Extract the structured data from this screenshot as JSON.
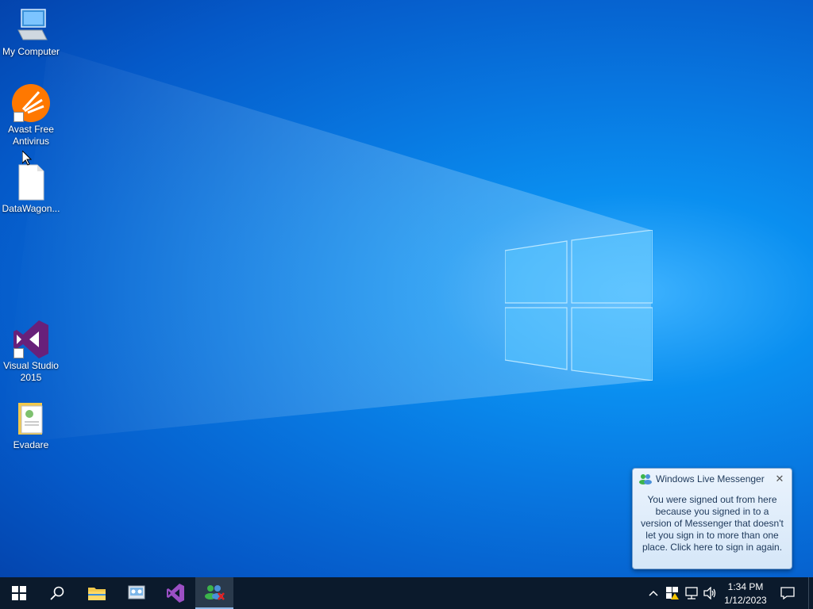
{
  "desktop": {
    "icons": [
      {
        "label": "My Computer",
        "icon": "computer-icon"
      },
      {
        "label": "Avast Free Antivirus",
        "icon": "avast-icon"
      },
      {
        "label": "DataWagon...",
        "icon": "file-icon"
      },
      {
        "label": "Visual Studio 2015",
        "icon": "visual-studio-icon"
      },
      {
        "label": "Evadare",
        "icon": "folder-icon"
      }
    ]
  },
  "notification": {
    "app": "Windows Live Messenger",
    "message": "You were signed out from here because you signed in to a version of Messenger that doesn't let you sign in to more than one place. Click here to sign in again.",
    "close_icon": "close-icon"
  },
  "taskbar": {
    "items": [
      {
        "name": "start",
        "icon": "windows-logo-icon"
      },
      {
        "name": "search",
        "icon": "search-icon"
      },
      {
        "name": "file-explorer",
        "icon": "folder-icon"
      },
      {
        "name": "control-panel",
        "icon": "control-panel-icon"
      },
      {
        "name": "visual-studio",
        "icon": "visual-studio-icon"
      },
      {
        "name": "windows-live-messenger",
        "icon": "messenger-icon",
        "active": true
      }
    ],
    "tray": [
      "chevron-up-icon",
      "security-warning-icon",
      "network-icon",
      "volume-icon"
    ],
    "clock": {
      "time": "1:34 PM",
      "date": "1/12/2023"
    },
    "notifications_icon": "action-center-icon"
  },
  "colors": {
    "taskbar": "#0b1a2c",
    "desktop_accent": "#0877e0",
    "messenger_toast": "#d6e7f8"
  }
}
